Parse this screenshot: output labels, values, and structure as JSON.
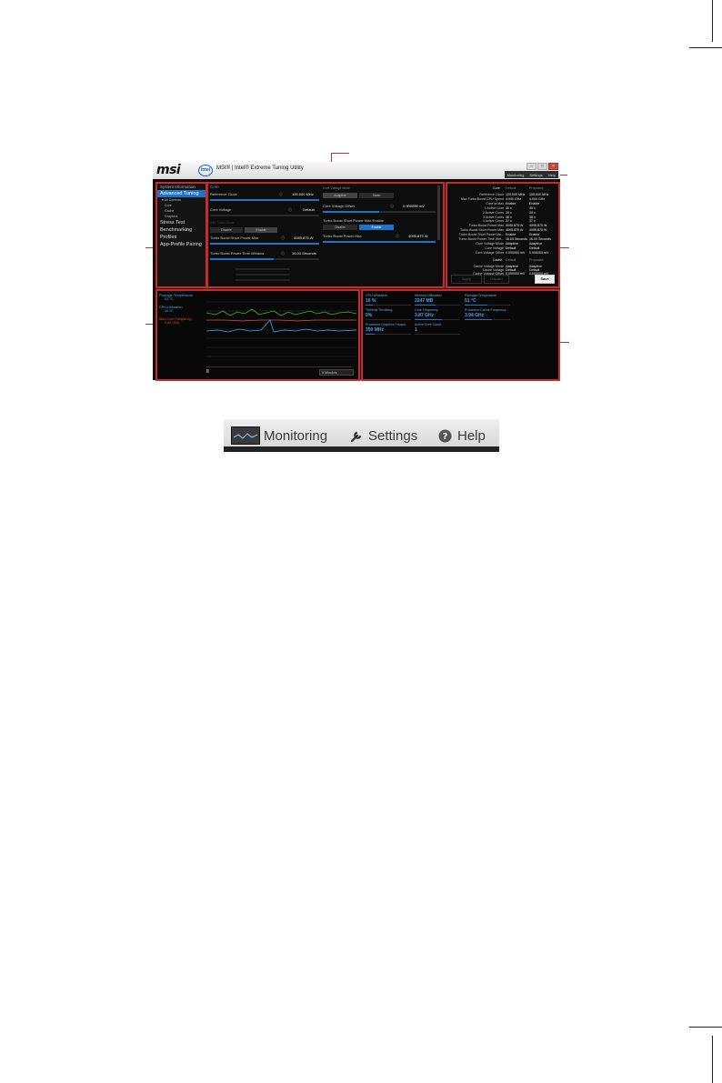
{
  "window": {
    "brand": "msi",
    "intel_logo": "intel",
    "title": "MSI® | Intel® Extreme Tuning Utility",
    "controls": [
      "–",
      "□",
      "×"
    ]
  },
  "topnav": {
    "items": [
      "Monitoring",
      "Settings",
      "Help"
    ]
  },
  "sidebar": {
    "header": "System Information",
    "items": [
      {
        "label": "Advanced Tuning",
        "active": true,
        "sub": false
      },
      {
        "label": "▾ All Controls",
        "active": false,
        "sub": true
      },
      {
        "label": "Core",
        "active": false,
        "sub": true
      },
      {
        "label": "Cache",
        "active": false,
        "sub": true
      },
      {
        "label": "Graphics",
        "active": false,
        "sub": true
      },
      {
        "label": "Stress Test",
        "active": false,
        "sub": false
      },
      {
        "label": "Benchmarking",
        "active": false,
        "sub": false
      },
      {
        "label": "Profiles",
        "active": false,
        "sub": false
      },
      {
        "label": "App-Profile Pairing",
        "active": false,
        "sub": false
      }
    ]
  },
  "main": {
    "section": "Core",
    "reference_clock": {
      "label": "Reference Clock",
      "value": "100.000 MHz",
      "fill": 1.0
    },
    "core_voltage": {
      "label": "Core Voltage",
      "value": "Default",
      "fill": 0.0
    },
    "ia_turbo": {
      "label": "Intel Turbo Boost",
      "options": [
        "Disable",
        "Enable"
      ]
    },
    "turbo_short_power": {
      "label": "Turbo Boost Short Power Max",
      "value": "4095.875 W",
      "fill": 1.0
    },
    "turbo_time_window": {
      "label": "Turbo Boost Power Time Window",
      "value": "16.00 Seconds",
      "fill": 0.58
    },
    "core_voltage_mode": {
      "label": "Core Voltage Mode",
      "options": [
        "Adaptive",
        "Static"
      ]
    },
    "core_voltage_offset": {
      "label": "Core Voltage Offset",
      "value": "0.000000 mV",
      "fill": 0.5
    },
    "turbo_short_enable": {
      "label": "Turbo Boost Short Power Max Enable",
      "options": [
        "Disable",
        "Enable"
      ]
    },
    "turbo_power_max": {
      "label": "Turbo Boost Power Max",
      "value": "4095.875 W",
      "fill": 1.0
    }
  },
  "summary": {
    "col_headers": [
      "Core",
      "Default",
      "Proposed"
    ],
    "core_rows": [
      [
        "Reference Clock",
        "100.000 MHz",
        "100.000 MHz"
      ],
      [
        "Max Turbo Boost CPU Speed",
        "4.000 GHz",
        "4.000 GHz"
      ],
      [
        "Core Ia Max",
        "Enable",
        "Enable"
      ],
      [
        "1 Active Core",
        "40 x",
        "40 x"
      ],
      [
        "2 Active Cores",
        "39 x",
        "39 x"
      ],
      [
        "3 Active Cores",
        "38 x",
        "38 x"
      ],
      [
        "4 Active Cores",
        "37 x",
        "37 x"
      ],
      [
        "Turbo Boost Power Max",
        "4095.875 W",
        "4095.875 W"
      ],
      [
        "Turbo Boost Short Power Max",
        "4095.875 W",
        "4095.875 W"
      ],
      [
        "Turbo Boost Short Power Ma...",
        "Enable",
        "Enable"
      ],
      [
        "Turbo Boost Power Time Win...",
        "16.00 Seconds",
        "16.00 Seconds"
      ],
      [
        "Core Voltage Mode",
        "Adaptive",
        "Adaptive"
      ],
      [
        "Core Voltage",
        "Default",
        "Default"
      ],
      [
        "Core Voltage Offset",
        "0.000000 mV",
        "0.000000 mV"
      ]
    ],
    "cache_headers": [
      "Cache",
      "Default",
      "Proposed"
    ],
    "cache_rows": [
      [
        "Cache Voltage Mode",
        "Adaptive",
        "Adaptive"
      ],
      [
        "Cache Voltage",
        "Default",
        "Default"
      ],
      [
        "Cache Voltage Offset",
        "0.000000 mV",
        "0.000000 mV"
      ]
    ],
    "buttons": {
      "apply": "Apply",
      "discard": "Discard",
      "save": "Save"
    }
  },
  "graph": {
    "legend": [
      {
        "label": "Package Temperature",
        "value": "51 °C",
        "color": "#4ea3e8"
      },
      {
        "label": "CPU Utilization",
        "value": "16 %",
        "color": "#4ea3e8"
      },
      {
        "label": "Max Core Frequency",
        "value": "3.86 GHz",
        "color": "#d9483b"
      }
    ],
    "pause": "II",
    "range": "5 Minutes"
  },
  "stats": {
    "items": [
      {
        "label": "CPU Utilization",
        "value": "16 %",
        "fill": 0.16
      },
      {
        "label": "Memory Utilization",
        "value": "2247 MB",
        "fill": 0.45
      },
      {
        "label": "Package Temperature",
        "value": "51 °C",
        "fill": 0.5
      },
      {
        "label": "Thermal Throttling",
        "value": "0%",
        "fill": 0.0
      },
      {
        "label": "Core Frequency",
        "value": "3.87 GHz",
        "fill": 0.6
      },
      {
        "label": "Processor Cache Frequency",
        "value": "3.94 GHz",
        "fill": 0.6
      },
      {
        "label": "Processor Graphics Freque",
        "value": "350 MHz",
        "fill": 0.2
      },
      {
        "label": "Active Core Count",
        "value": "1",
        "fill": 0.0
      }
    ]
  },
  "zoom_menu": {
    "items": [
      {
        "label": "Monitoring",
        "icon": "monitoring-icon"
      },
      {
        "label": "Settings",
        "icon": "wrench-icon"
      },
      {
        "label": "Help",
        "icon": "help-icon"
      }
    ]
  },
  "colors": {
    "accent": "#1d73c5",
    "callout": "#c82b2b",
    "background": "#0b0b0b"
  }
}
